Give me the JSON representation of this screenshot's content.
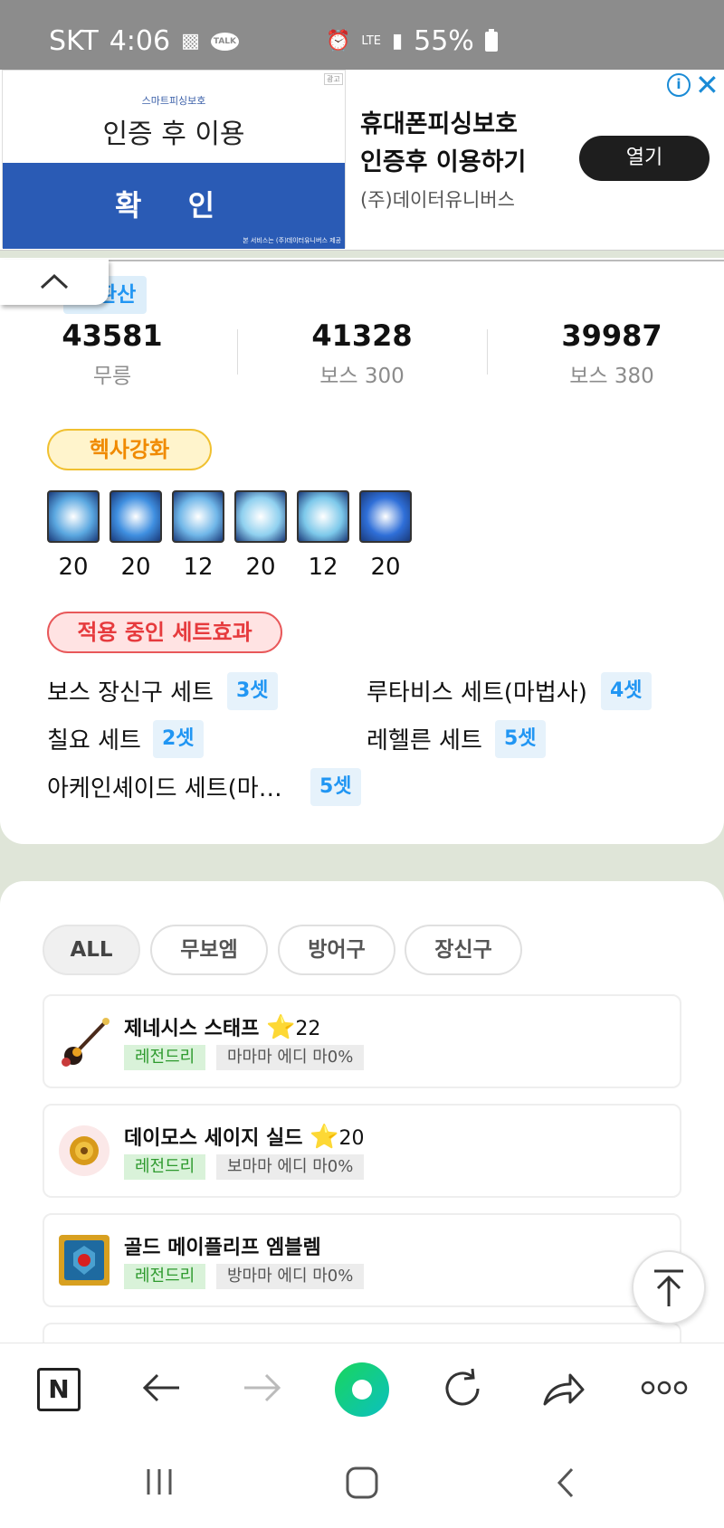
{
  "status_bar": {
    "carrier": "SKT",
    "time": "4:06",
    "talk_label": "TALK",
    "network": "LTE",
    "battery": "55%"
  },
  "ad": {
    "small_caption": "스마트피싱보호",
    "left_title": "인증 후 이용",
    "confirm_label": "확 인",
    "footer": "본 서비스는 (주)데이터유니버스 제공",
    "tag": "광고",
    "headline_1": "휴대폰피싱보호",
    "headline_2": "인증후 이용하기",
    "company": "(주)데이터유니버스",
    "open_label": "열기"
  },
  "conversion": {
    "label": "환산",
    "stats": [
      {
        "value": "43581",
        "label": "무릉"
      },
      {
        "value": "41328",
        "label": "보스 300"
      },
      {
        "value": "39987",
        "label": "보스 380"
      }
    ]
  },
  "hexa": {
    "label": "헥사강화",
    "skills": [
      {
        "level": "20",
        "icon": "hexa-skill-icon-1",
        "color": "#5aa7e0"
      },
      {
        "level": "20",
        "icon": "hexa-skill-icon-2",
        "color": "#3f8fe0"
      },
      {
        "level": "12",
        "icon": "hexa-skill-icon-3",
        "color": "#6fb6e8"
      },
      {
        "level": "20",
        "icon": "hexa-skill-icon-4",
        "color": "#8fd0ef"
      },
      {
        "level": "12",
        "icon": "hexa-skill-icon-5",
        "color": "#7cc8ea"
      },
      {
        "level": "20",
        "icon": "hexa-skill-icon-6",
        "color": "#2f6fd8"
      }
    ]
  },
  "set_effects": {
    "label": "적용 중인 세트효과",
    "items": [
      {
        "name": "보스 장신구 세트",
        "count": "3셋"
      },
      {
        "name": "루타비스 세트(마법사)",
        "count": "4셋"
      },
      {
        "name": "칠요 세트",
        "count": "2셋"
      },
      {
        "name": "레헬른 세트",
        "count": "5셋"
      },
      {
        "name": "아케인셰이드 세트(마…",
        "count": "5셋"
      }
    ]
  },
  "equipment": {
    "tabs": [
      {
        "label": "ALL",
        "active": true
      },
      {
        "label": "무보엠",
        "active": false
      },
      {
        "label": "방어구",
        "active": false
      },
      {
        "label": "장신구",
        "active": false
      }
    ],
    "items": [
      {
        "name": "제네시스 스태프",
        "star": "⭐",
        "stars": "22",
        "grade": "레전드리",
        "potential": "마마마 에디 마0%"
      },
      {
        "name": "데이모스 세이지 실드",
        "star": "⭐",
        "stars": "20",
        "grade": "레전드리",
        "potential": "보마마 에디 마0%"
      },
      {
        "name": "골드 메이플리프 엠블렘",
        "star": "",
        "stars": "",
        "grade": "레전드리",
        "potential": "방마마 에디 마0%"
      }
    ]
  },
  "browser_bar": {
    "n_label": "N"
  },
  "colors": {
    "accent_blue": "#2196f3",
    "hexa_orange": "#f08a00",
    "set_red": "#e63a3d",
    "legend_green": "#2e9a2e"
  }
}
